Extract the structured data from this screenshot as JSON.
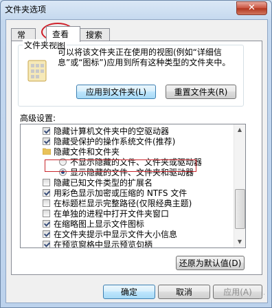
{
  "window": {
    "title": "文件夹选项",
    "close_glyph": "✕"
  },
  "tabs": [
    {
      "label": "常规"
    },
    {
      "label": "查看",
      "active": true
    },
    {
      "label": "搜索"
    }
  ],
  "folder_views": {
    "legend": "文件夹视图",
    "description": "可以将该文件夹正在使用的视图(例如“详细信息”或“图标”)应用到所有这种类型的文件夹中。",
    "apply_button": "应用到文件夹(L)",
    "reset_button": "重置文件夹(R)"
  },
  "advanced": {
    "label": "高级设置:",
    "items": [
      {
        "type": "checkbox",
        "label": "隐藏计算机文件夹中的空驱动器",
        "checked": true
      },
      {
        "type": "checkbox",
        "label": "隐藏受保护的操作系统文件(推荐)",
        "checked": true
      },
      {
        "type": "folder",
        "label": "隐藏文件和文件夹"
      },
      {
        "type": "radio",
        "label": "不显示隐藏的文件、文件夹或驱动器",
        "checked": false
      },
      {
        "type": "radio",
        "label": "显示隐藏的文件、文件夹和驱动器",
        "checked": true
      },
      {
        "type": "checkbox",
        "label": "隐藏已知文件类型的扩展名",
        "checked": false
      },
      {
        "type": "checkbox",
        "label": "用彩色显示加密或压缩的 NTFS 文件",
        "checked": true
      },
      {
        "type": "checkbox",
        "label": "在标题栏显示完整路径(仅限经典主题)",
        "checked": false
      },
      {
        "type": "checkbox",
        "label": "在单独的进程中打开文件夹窗口",
        "checked": false
      },
      {
        "type": "checkbox",
        "label": "在缩略图上显示文件图标",
        "checked": true
      },
      {
        "type": "checkbox",
        "label": "在文件夹提示中显示文件大小信息",
        "checked": true
      },
      {
        "type": "checkbox",
        "label": "在预览窗格中显示预览句柄",
        "checked": true
      }
    ],
    "restore_button": "还原为默认值(D)"
  },
  "footer": {
    "ok": "确定",
    "cancel": "取消",
    "apply": "应用(A)"
  },
  "colors": {
    "annotation_red": "#c8252c",
    "accent_blue": "#3c7fb1"
  }
}
